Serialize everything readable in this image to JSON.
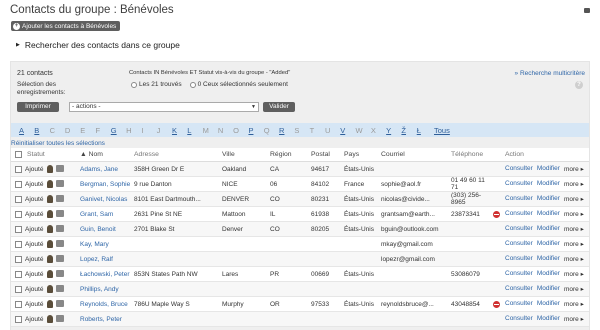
{
  "header": {
    "title": "Contacts du groupe : Bénévoles"
  },
  "add_button": "Ajouter les contacts à Bénévoles",
  "search_toggle": "Rechercher des contacts dans ce groupe",
  "results": {
    "count": "21 contacts",
    "criteria": "Contacts IN Bénévoles ET Statut vis-à-vis du groupe - \"Added\"",
    "multi_link": "» Recherche multicritère",
    "selection_label": "Sélection des enregistrements:",
    "radio_all": "Les 21 trouvés",
    "radio_selected": "0 Ceux sélectionnés seulement",
    "print_btn": "Imprimer",
    "actions_placeholder": "- actions -",
    "validate_btn": "Valider",
    "reset_link": "Réinitialiser toutes les sélections"
  },
  "alphabet": [
    {
      "l": "A",
      "on": true
    },
    {
      "l": "B",
      "on": true
    },
    {
      "l": "C",
      "on": false
    },
    {
      "l": "D",
      "on": false
    },
    {
      "l": "E",
      "on": false
    },
    {
      "l": "F",
      "on": false
    },
    {
      "l": "G",
      "on": true
    },
    {
      "l": "H",
      "on": false
    },
    {
      "l": "I",
      "on": false
    },
    {
      "l": "J",
      "on": false
    },
    {
      "l": "K",
      "on": true
    },
    {
      "l": "L",
      "on": true
    },
    {
      "l": "M",
      "on": false
    },
    {
      "l": "N",
      "on": false
    },
    {
      "l": "O",
      "on": false
    },
    {
      "l": "P",
      "on": true
    },
    {
      "l": "Q",
      "on": false
    },
    {
      "l": "R",
      "on": true
    },
    {
      "l": "S",
      "on": false
    },
    {
      "l": "T",
      "on": false
    },
    {
      "l": "U",
      "on": false
    },
    {
      "l": "V",
      "on": true
    },
    {
      "l": "W",
      "on": false
    },
    {
      "l": "X",
      "on": false
    },
    {
      "l": "Y",
      "on": true
    },
    {
      "l": "Ž",
      "on": true
    },
    {
      "l": "Ł",
      "on": true
    }
  ],
  "alphabet_all": "Tous",
  "columns": {
    "status": "Statut",
    "name": "▲ Nom",
    "address": "Adresse",
    "city": "Ville",
    "region": "Région",
    "postal": "Postal",
    "country": "Pays",
    "email": "Courriel",
    "phone": "Téléphone",
    "action": "Action"
  },
  "rows": [
    {
      "status": "Ajouté",
      "name": "Adams, Jane",
      "address": "358H Green Dr E",
      "city": "Oakland",
      "region": "CA",
      "postal": "94617",
      "country": "États-Unis",
      "email": "",
      "phone": "",
      "noentry": false
    },
    {
      "status": "Ajouté",
      "name": "Bergman, Sophie",
      "address": "9 rue Danton",
      "city": "NICE",
      "region": "06",
      "postal": "84102",
      "country": "France",
      "email": "sophie@aol.fr",
      "phone": "01 49 60 11 71",
      "noentry": false
    },
    {
      "status": "Ajouté",
      "name": "Ganivet, Nicolas",
      "address": "8101 East Dartmouth...",
      "city": "DENVER",
      "region": "CO",
      "postal": "80231",
      "country": "États-Unis",
      "email": "nicolas@civide...",
      "phone": "(303) 256-8965",
      "noentry": false
    },
    {
      "status": "Ajouté",
      "name": "Grant, Sam",
      "address": "2631 Pine St NE",
      "city": "Mattoon",
      "region": "IL",
      "postal": "61938",
      "country": "États-Unis",
      "email": "grantsam@earth...",
      "phone": "23873341",
      "noentry": true
    },
    {
      "status": "Ajouté",
      "name": "Guin, Benoit",
      "address": "2701 Blake St",
      "city": "Denver",
      "region": "CO",
      "postal": "80205",
      "country": "États-Unis",
      "email": "bguin@outlook.com",
      "phone": "",
      "noentry": false
    },
    {
      "status": "Ajouté",
      "name": "Kay, Mary",
      "address": "",
      "city": "",
      "region": "",
      "postal": "",
      "country": "",
      "email": "mkay@gmail.com",
      "phone": "",
      "noentry": false
    },
    {
      "status": "Ajouté",
      "name": "Lopez, Ralf",
      "address": "",
      "city": "",
      "region": "",
      "postal": "",
      "country": "",
      "email": "lopezr@gmail.com",
      "phone": "",
      "noentry": false
    },
    {
      "status": "Ajouté",
      "name": "Łachowski, Peter",
      "address": "853N States Path NW",
      "city": "Lares",
      "region": "PR",
      "postal": "00669",
      "country": "États-Unis",
      "email": "",
      "phone": "53086079",
      "noentry": false
    },
    {
      "status": "Ajouté",
      "name": "Phillips, Andy",
      "address": "",
      "city": "",
      "region": "",
      "postal": "",
      "country": "",
      "email": "",
      "phone": "",
      "noentry": false
    },
    {
      "status": "Ajouté",
      "name": "Reynolds, Bruce",
      "address": "786U Maple Way S",
      "city": "Murphy",
      "region": "OR",
      "postal": "97533",
      "country": "États-Unis",
      "email": "reynoldsbruce@...",
      "phone": "43048854",
      "noentry": true
    },
    {
      "status": "Ajouté",
      "name": "Roberts, Peter",
      "address": "",
      "city": "",
      "region": "",
      "postal": "",
      "country": "",
      "email": "",
      "phone": "",
      "noentry": false
    }
  ],
  "row_actions": {
    "view": "Consulter",
    "edit": "Modifier",
    "more": "more ▸"
  }
}
